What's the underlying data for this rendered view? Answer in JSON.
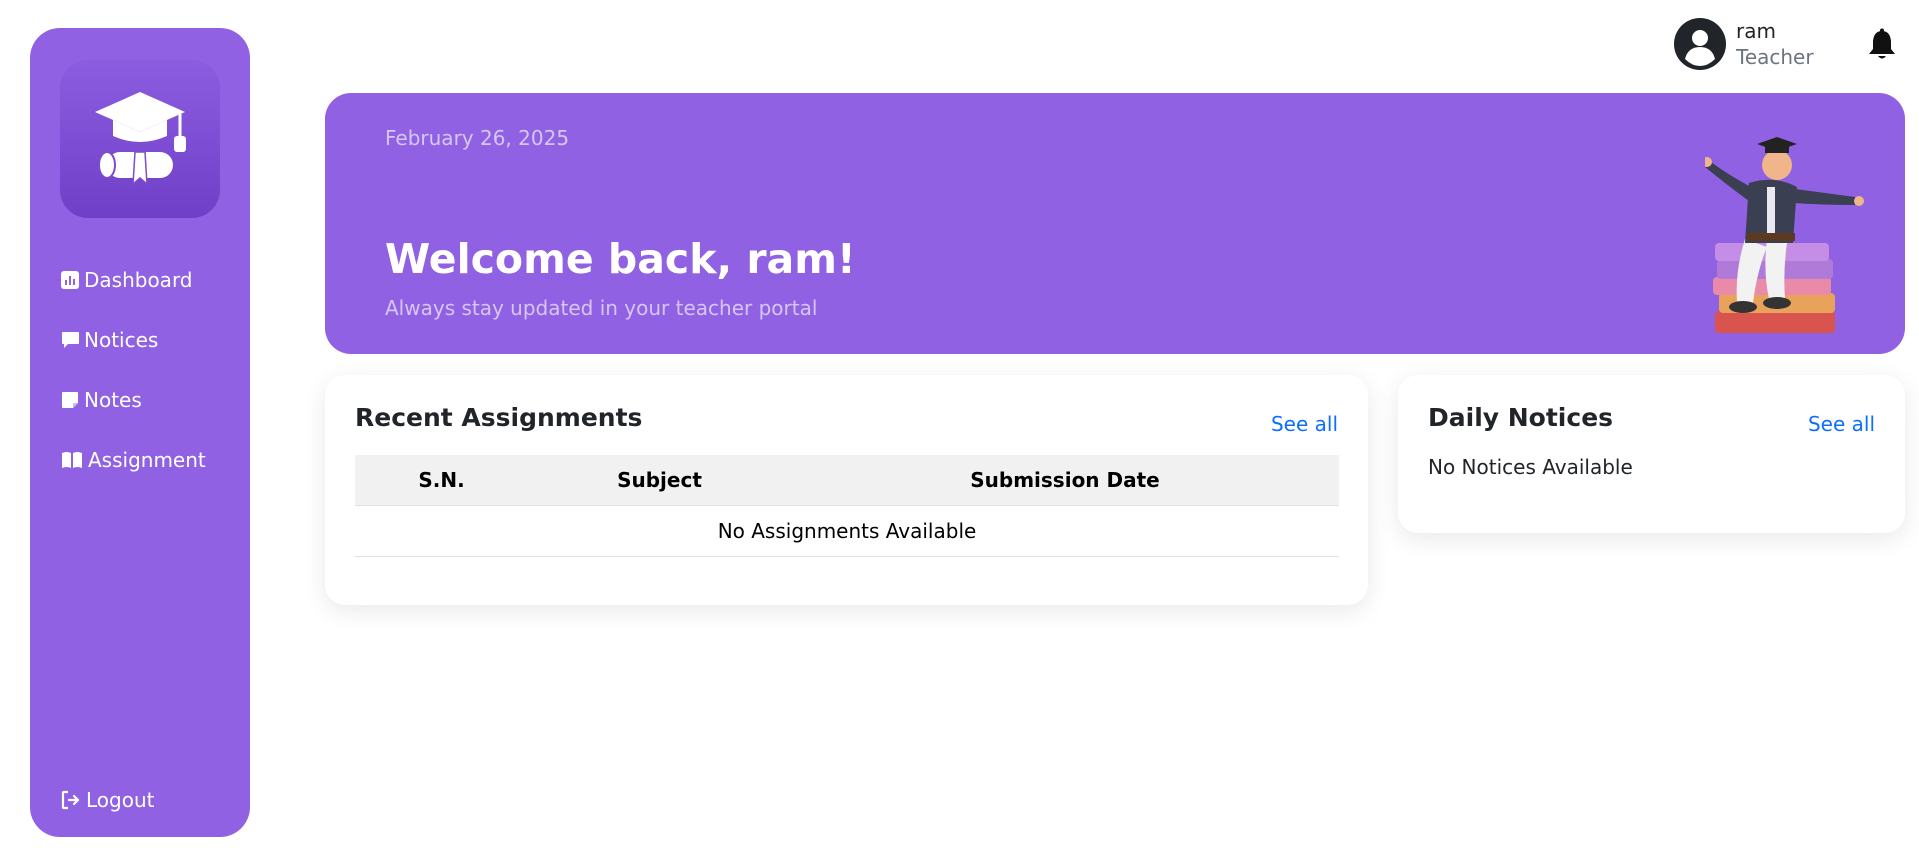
{
  "sidebar": {
    "logo": "graduation-cap-diploma-logo",
    "items": [
      {
        "label": "Dashboard",
        "icon": "chart-icon"
      },
      {
        "label": "Notices",
        "icon": "message-icon"
      },
      {
        "label": "Notes",
        "icon": "note-icon"
      },
      {
        "label": "Assignment",
        "icon": "book-icon"
      }
    ],
    "logout": {
      "label": "Logout",
      "icon": "logout-icon"
    }
  },
  "header": {
    "user": {
      "name": "ram",
      "role": "Teacher",
      "icon": "user-circle-icon"
    },
    "notifications_icon": "bell-icon"
  },
  "banner": {
    "date": "February 26, 2025",
    "title": "Welcome back, ram!",
    "subtitle": "Always stay updated in your teacher portal",
    "illustration": "student-sitting-on-books"
  },
  "assignments": {
    "title": "Recent Assignments",
    "see_all": "See all",
    "columns": [
      "S.N.",
      "Subject",
      "Submission Date"
    ],
    "empty": "No Assignments Available"
  },
  "notices": {
    "title": "Daily Notices",
    "see_all": "See all",
    "empty": "No Notices Available"
  },
  "colors": {
    "primary": "#9061e2",
    "link": "#0d6efd"
  }
}
